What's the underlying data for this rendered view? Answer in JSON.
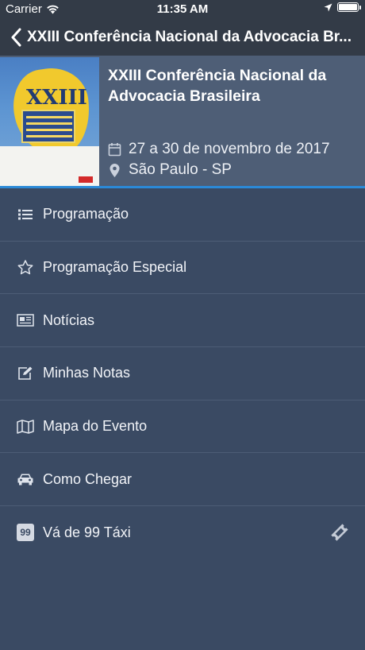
{
  "status_bar": {
    "carrier": "Carrier",
    "time": "11:35 AM"
  },
  "nav": {
    "title": "XXIII Conferência Nacional da Advocacia Br..."
  },
  "event": {
    "title": "XXIII Conferência Nacional da Advocacia Brasileira",
    "date": "27 a 30 de novembro de 2017",
    "location": "São Paulo - SP",
    "poster_text": "XXIII"
  },
  "menu": [
    {
      "label": "Programação",
      "icon": "list-icon"
    },
    {
      "label": "Programação Especial",
      "icon": "star-icon"
    },
    {
      "label": "Notícias",
      "icon": "newspaper-icon"
    },
    {
      "label": "Minhas Notas",
      "icon": "edit-note-icon"
    },
    {
      "label": "Mapa do Evento",
      "icon": "map-icon"
    },
    {
      "label": "Como Chegar",
      "icon": "car-icon"
    },
    {
      "label": "Vá de 99 Táxi",
      "icon": "taxi-99-icon",
      "badge": "99",
      "trailing_icon": "ticket-icon"
    }
  ],
  "colors": {
    "background": "#3a4a63",
    "header": "#4e5e76",
    "navbar": "#333b47",
    "accent": "#2b8ad8"
  }
}
